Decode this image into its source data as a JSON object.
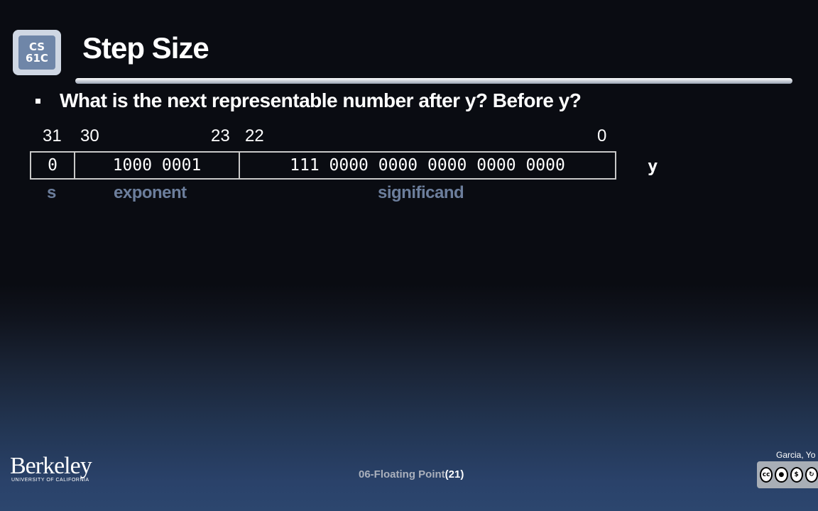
{
  "logo": {
    "line1": "CS",
    "line2": "61C"
  },
  "slide": {
    "title": "Step Size",
    "question": "What is the next representable number after y? Before y?"
  },
  "bit_positions": {
    "b31": "31",
    "b30": "30",
    "b23": "23",
    "b22": "22",
    "b0": "0"
  },
  "float_bits": {
    "sign": "0",
    "exponent": "1000 0001",
    "significand": "111 0000 0000 0000 0000 0000",
    "var_name": "y"
  },
  "field_labels": {
    "sign": "s",
    "exponent": "exponent",
    "significand": "significand"
  },
  "footer": {
    "institution": "Berkeley",
    "institution_sub": "UNIVERSITY OF CALIFORNIA",
    "lecture": "06-Floating Point",
    "page": "(21)",
    "author": "Garcia, Yo"
  },
  "license_icons": [
    "cc-icon",
    "by-icon",
    "nc-icon",
    "sa-icon"
  ]
}
